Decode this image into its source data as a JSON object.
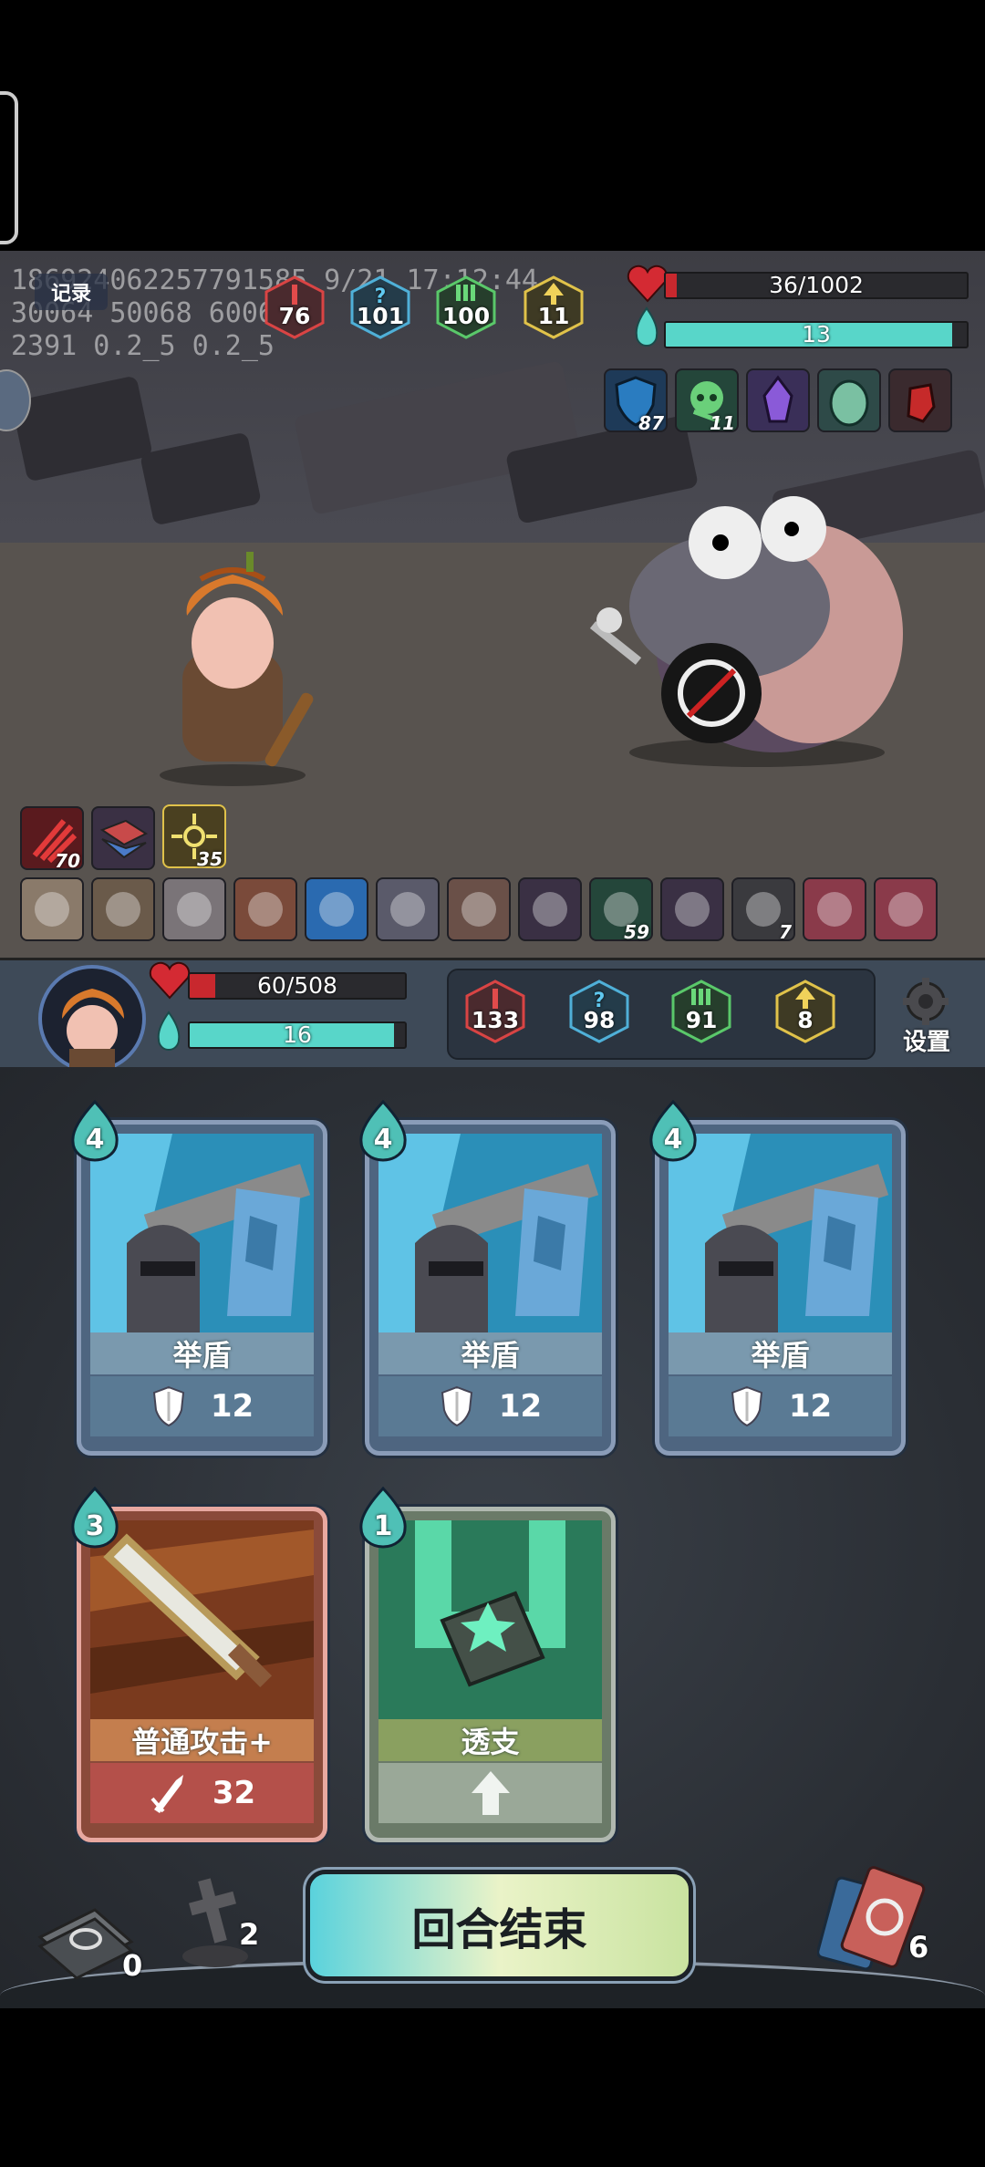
{
  "debug": {
    "line1": "186924062257791585 9/21 17:12:44",
    "line2": "30064 50068 60063",
    "line3": "2391 0.2_5 0.2_5"
  },
  "record_label": "记录",
  "enemy": {
    "hp_text": "36/1002",
    "hp_fraction": 0.036,
    "mana_text": "13",
    "mana_fraction": 0.95,
    "stats": [
      "76",
      "101",
      "100",
      "11"
    ],
    "buffs": [
      {
        "icon": "shield-icon",
        "count": "87"
      },
      {
        "icon": "poison-skull-icon",
        "count": "11"
      },
      {
        "icon": "purple-crystal-icon",
        "count": ""
      },
      {
        "icon": "egg-icon",
        "count": ""
      },
      {
        "icon": "gauntlet-icon",
        "count": ""
      }
    ]
  },
  "player_buffs_row1": [
    {
      "icon": "claw-slash-icon",
      "count": "70"
    },
    {
      "icon": "broken-shield-icon",
      "count": ""
    },
    {
      "icon": "star-burst-icon",
      "count": "35"
    }
  ],
  "player_relics_row2": [
    {
      "icon": "cauldron-icon",
      "count": ""
    },
    {
      "icon": "fang-icon",
      "count": ""
    },
    {
      "icon": "glove-icon",
      "count": ""
    },
    {
      "icon": "meat-icon",
      "count": ""
    },
    {
      "icon": "water-orb-icon",
      "count": ""
    },
    {
      "icon": "potion-icon",
      "count": ""
    },
    {
      "icon": "horn-icon",
      "count": ""
    },
    {
      "icon": "broken-shield-icon",
      "count": ""
    },
    {
      "icon": "poison-skull-icon",
      "count": "59"
    },
    {
      "icon": "broken-shield-icon",
      "count": ""
    },
    {
      "icon": "dice-icon",
      "count": "7"
    },
    {
      "icon": "red-gem-icon",
      "count": ""
    },
    {
      "icon": "red-gem-icon",
      "count": ""
    }
  ],
  "player": {
    "hp_text": "60/508",
    "hp_fraction": 0.118,
    "mana_text": "16",
    "mana_fraction": 0.95,
    "stats": [
      "133",
      "98",
      "91",
      "8"
    ]
  },
  "settings_label": "设置",
  "cards": [
    {
      "cost": "4",
      "name": "举盾",
      "value": "12",
      "value_icon": "shield-icon",
      "type": "skill"
    },
    {
      "cost": "4",
      "name": "举盾",
      "value": "12",
      "value_icon": "shield-icon",
      "type": "skill"
    },
    {
      "cost": "4",
      "name": "举盾",
      "value": "12",
      "value_icon": "shield-icon",
      "type": "skill"
    },
    {
      "cost": "3",
      "name": "普通攻击+",
      "value": "32",
      "value_icon": "sword-damage-icon",
      "type": "attack"
    },
    {
      "cost": "1",
      "name": "透支",
      "value": "",
      "value_icon": "up-arrow-icon",
      "type": "power"
    }
  ],
  "piles": {
    "draw_count": "0",
    "graveyard_count": "2",
    "discard_count": "6"
  },
  "end_turn_label": "回合结束",
  "colors": {
    "hp": "#c8282e",
    "mana": "#58d6c9",
    "stat_red": "#d94444",
    "stat_blue": "#4fb0d8",
    "stat_green": "#5ac86a",
    "stat_yellow": "#e0c24a"
  }
}
